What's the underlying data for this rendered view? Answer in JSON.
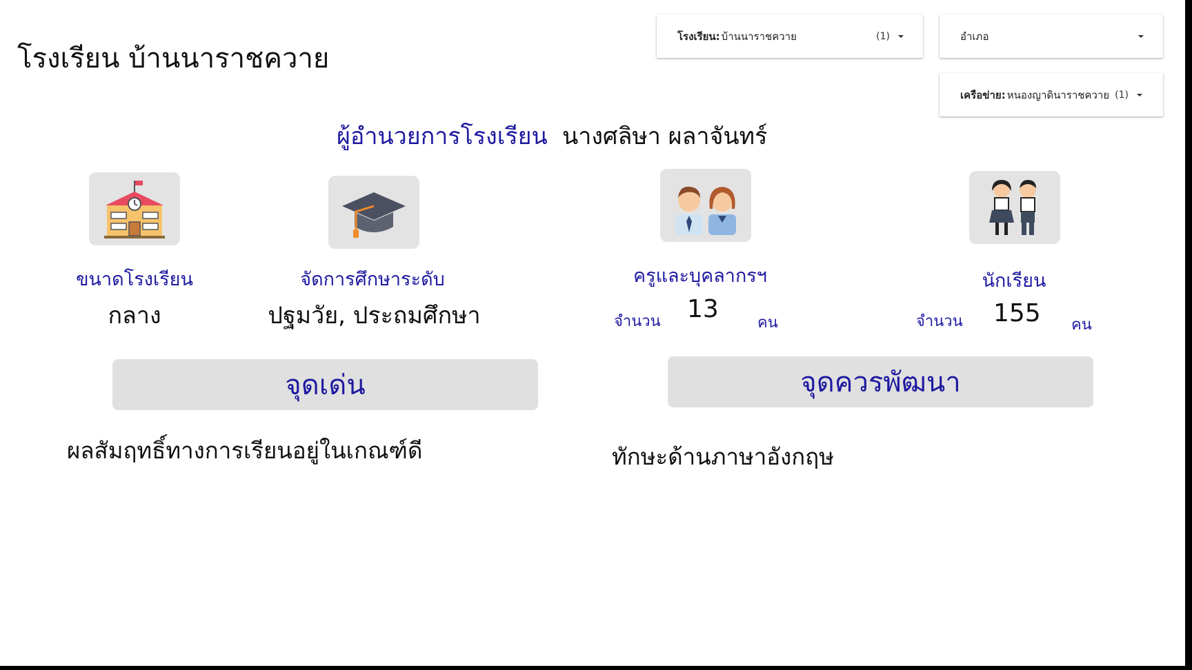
{
  "page": {
    "title": "โรงเรียน บ้านนาราชควาย"
  },
  "filters": {
    "school": {
      "label": "โรงเรียน:",
      "value": "บ้านนาราชควาย",
      "count": "(1)"
    },
    "district": {
      "label": "อำเภอ"
    },
    "network": {
      "label": "เครือข่าย:",
      "value": "หนองญาดินาราชควาย",
      "count": "(1)"
    }
  },
  "director": {
    "label": "ผู้อำนวยการโรงเรียน",
    "name": "นางศลิษา ผลาจันทร์"
  },
  "stats": {
    "school_size": {
      "icon": "school-building-icon",
      "label": "ขนาดโรงเรียน",
      "value": "กลาง"
    },
    "education_level": {
      "icon": "graduation-cap-icon",
      "label": "จัดการศึกษาระดับ",
      "value": "ปฐมวัย, ประถมศึกษา"
    },
    "teachers": {
      "icon": "teachers-icon",
      "label": "ครูและบุคลากรฯ",
      "count_label": "จำนวน",
      "value": "13",
      "unit": "คน"
    },
    "students": {
      "icon": "students-icon",
      "label": "นักเรียน",
      "count_label": "จำนวน",
      "value": "155",
      "unit": "คน"
    }
  },
  "strengths": {
    "header": "จุดเด่น",
    "text": "ผลสัมฤทธิ์ทางการเรียนอยู่ในเกณฑ์ดี"
  },
  "improvements": {
    "header": "จุดควรพัฒนา",
    "text": "ทักษะด้านภาษาอังกฤษ"
  },
  "colors": {
    "accent_text": "#1f1aa0",
    "panel_bg": "#e0e0e0"
  }
}
